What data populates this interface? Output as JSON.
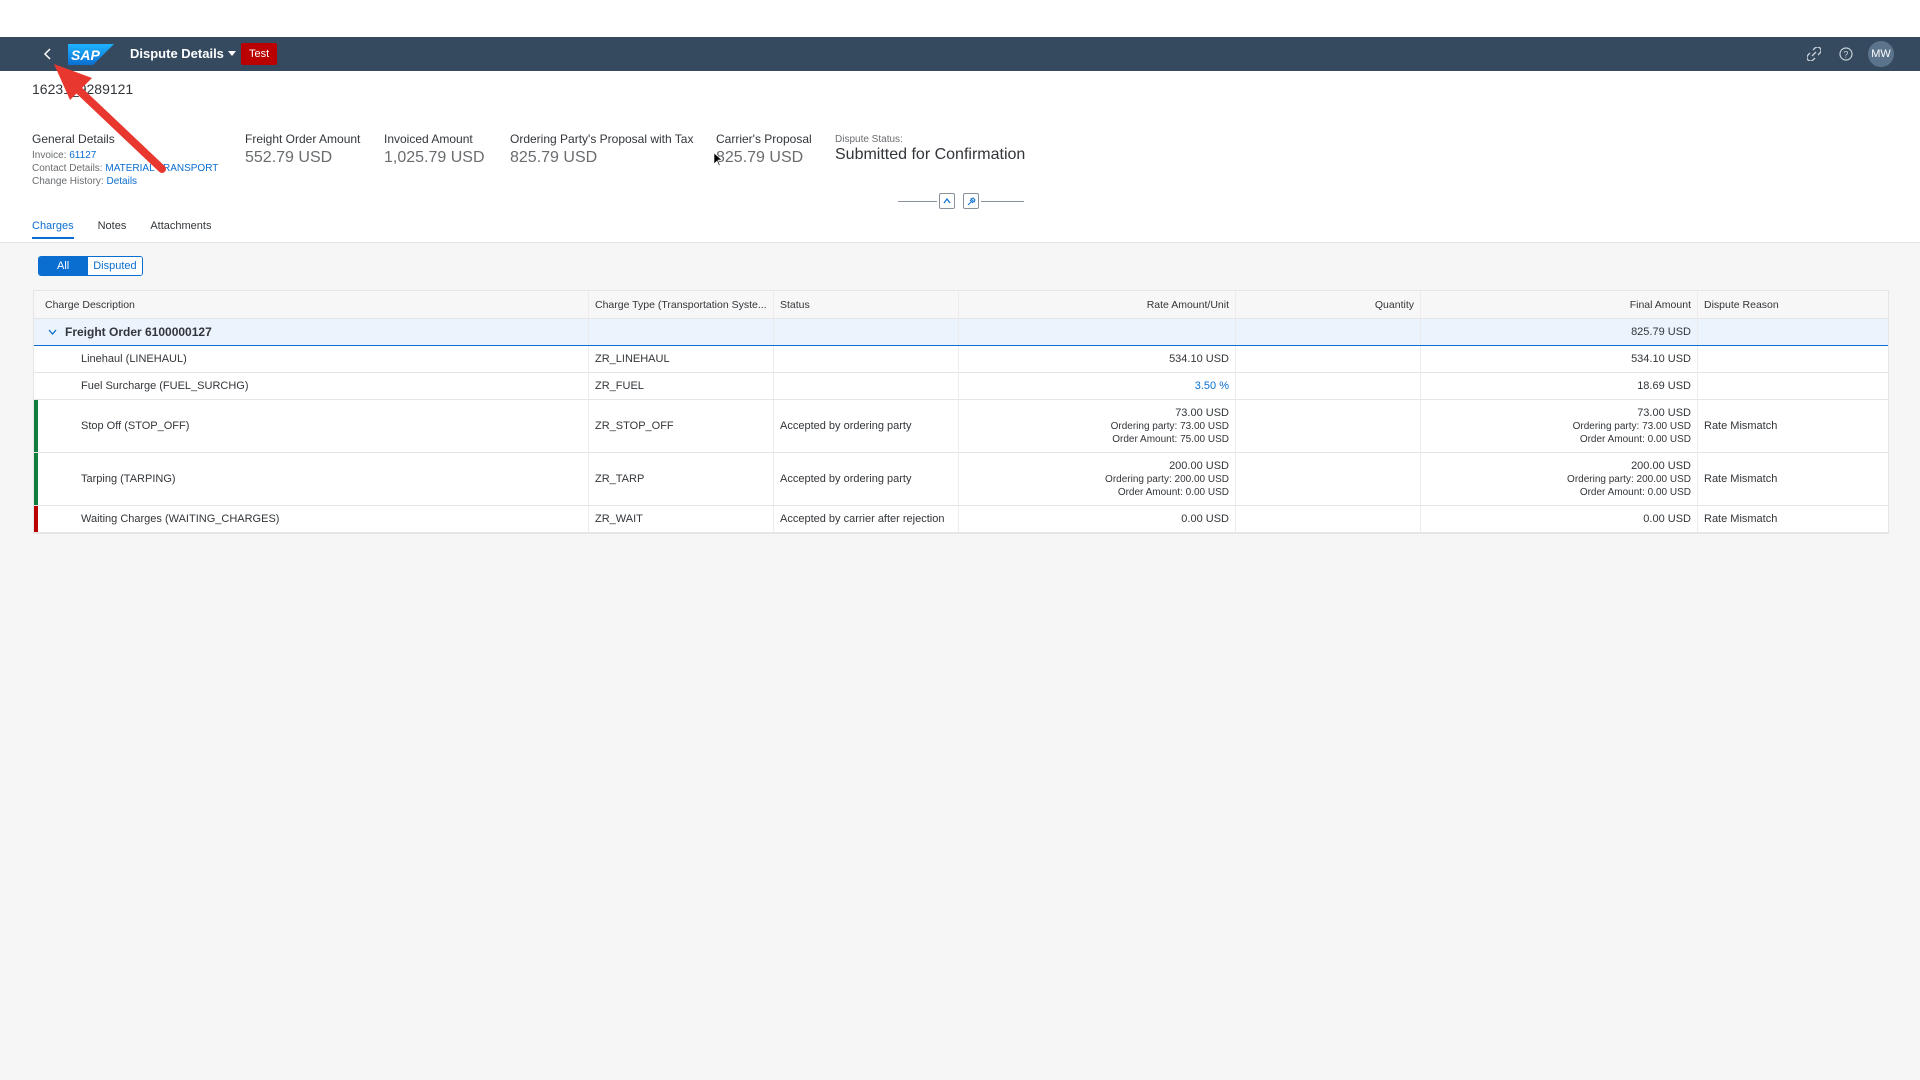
{
  "shell": {
    "logo": "SAP",
    "app_title": "Dispute Details",
    "env_badge": "Test",
    "avatar_initials": "MW",
    "icons": [
      "back-icon",
      "chevron-down-icon",
      "link-icon",
      "help-icon"
    ]
  },
  "header": {
    "object_id": "16231_9289121",
    "general": {
      "label": "General Details",
      "invoice_label": "Invoice:",
      "invoice_value": "61127",
      "contact_label": "Contact Details:",
      "contact_value": "MATERIAL TRANSPORT",
      "history_label": "Change History:",
      "history_value": "Details"
    },
    "kpis": [
      {
        "label": "Freight Order Amount",
        "value": "552.79 USD"
      },
      {
        "label": "Invoiced Amount",
        "value": "1,025.79 USD"
      },
      {
        "label": "Ordering Party's Proposal with Tax",
        "value": "825.79 USD"
      },
      {
        "label": "Carrier's Proposal",
        "value": "825.79 USD"
      }
    ],
    "dispute_status": {
      "label": "Dispute Status:",
      "value": "Submitted for Confirmation"
    }
  },
  "tabs": [
    "Charges",
    "Notes",
    "Attachments"
  ],
  "filter": {
    "all": "All",
    "disputed": "Disputed"
  },
  "table": {
    "columns": [
      "Charge Description",
      "Charge Type (Transportation Syste...",
      "Status",
      "Rate Amount/Unit",
      "Quantity",
      "Final Amount",
      "Dispute Reason"
    ],
    "group": {
      "label": "Freight Order 6100000127",
      "final_amount": "825.79 USD"
    },
    "rows": [
      {
        "description": "Linehaul (LINEHAUL)",
        "type": "ZR_LINEHAUL",
        "status": "",
        "rate": "534.10 USD",
        "final": "534.10 USD",
        "reason": ""
      },
      {
        "description": "Fuel Surcharge (FUEL_SURCHG)",
        "type": "ZR_FUEL",
        "status": "",
        "rate": "3.50 %",
        "final": "18.69 USD",
        "reason": ""
      },
      {
        "description": "Stop Off (STOP_OFF)",
        "type": "ZR_STOP_OFF",
        "status": "Accepted by ordering party",
        "rate": "73.00 USD",
        "rate_op": "Ordering party: 73.00 USD",
        "rate_oa": "Order Amount: 75.00 USD",
        "final": "73.00 USD",
        "final_op": "Ordering party: 73.00 USD",
        "final_oa": "Order Amount: 0.00 USD",
        "reason": "Rate Mismatch",
        "indicator": "#107e3e"
      },
      {
        "description": "Tarping (TARPING)",
        "type": "ZR_TARP",
        "status": "Accepted by ordering party",
        "rate": "200.00 USD",
        "rate_op": "Ordering party: 200.00 USD",
        "rate_oa": "Order Amount: 0.00 USD",
        "final": "200.00 USD",
        "final_op": "Ordering party: 200.00 USD",
        "final_oa": "Order Amount: 0.00 USD",
        "reason": "Rate Mismatch",
        "indicator": "#107e3e"
      },
      {
        "description": "Waiting Charges (WAITING_CHARGES)",
        "type": "ZR_WAIT",
        "status": "Accepted by carrier after rejection",
        "rate": "0.00 USD",
        "final": "0.00 USD",
        "reason": "Rate Mismatch",
        "indicator": "#bb0000"
      }
    ]
  },
  "colors": {
    "shell": "#354a5f",
    "accent": "#0a6ed1",
    "badge": "#bb0000",
    "annotation": "#e8372f"
  }
}
